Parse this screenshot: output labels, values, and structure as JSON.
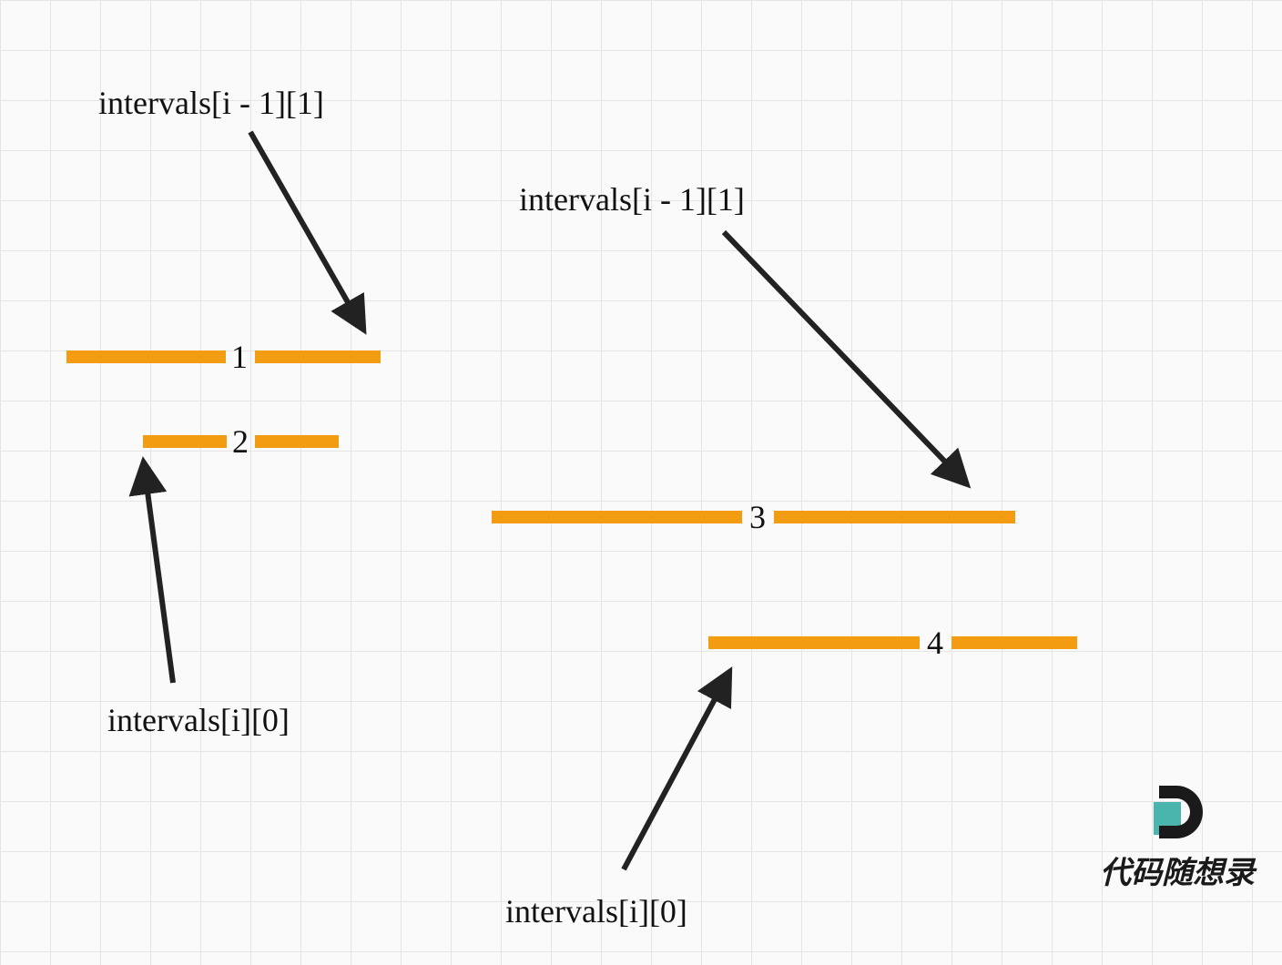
{
  "labels": {
    "top_left": "intervals[i - 1][1]",
    "top_right": "intervals[i - 1][1]",
    "bottom_left": "intervals[i][0]",
    "bottom_right": "intervals[i][0]"
  },
  "bars": {
    "bar1": {
      "number": "1"
    },
    "bar2": {
      "number": "2"
    },
    "bar3": {
      "number": "3"
    },
    "bar4": {
      "number": "4"
    }
  },
  "watermark": "代码随想录",
  "colors": {
    "bar": "#f39c12",
    "arrow": "#222222",
    "grid": "#e5e5e5"
  }
}
